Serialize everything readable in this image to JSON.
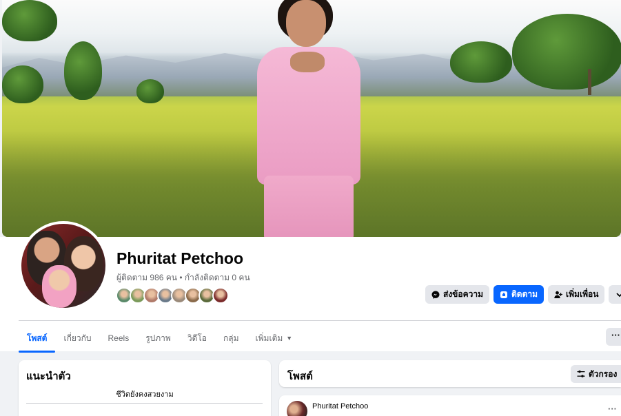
{
  "profile": {
    "name": "Phuritat Petchoo",
    "stats": "ผู้ติดตาม 986 คน • กำลังติดตาม 0 คน",
    "friend_colors": [
      "#5a8a6a",
      "#7a9a5a",
      "#b07a6a",
      "#6a7a8a",
      "#9a8a7a",
      "#8a6a4a",
      "#5a6a3a",
      "#7a2a2a"
    ]
  },
  "actions": {
    "message_label": "ส่งข้อความ",
    "follow_label": "ติดตาม",
    "add_friend_label": "เพิ่มเพื่อน",
    "more_icon": "chevron-down-icon"
  },
  "tabs": [
    {
      "label": "โพสต์",
      "active": true
    },
    {
      "label": "เกี่ยวกับ",
      "active": false
    },
    {
      "label": "Reels",
      "active": false
    },
    {
      "label": "รูปภาพ",
      "active": false
    },
    {
      "label": "วิดีโอ",
      "active": false
    },
    {
      "label": "กลุ่ม",
      "active": false
    },
    {
      "label": "เพิ่มเติม",
      "active": false
    }
  ],
  "tab_more_label": "···",
  "intro": {
    "title": "แนะนำตัว",
    "bio": "ชีวิตยังคงสวยงาม"
  },
  "posts": {
    "title": "โพสต์",
    "filter_label": "ตัวกรอง",
    "first_author": "Phuritat Petchoo",
    "post_menu": "···"
  },
  "colors": {
    "accent": "#0866ff",
    "gray_button": "#e4e6eb",
    "secondary_text": "#65676b"
  }
}
